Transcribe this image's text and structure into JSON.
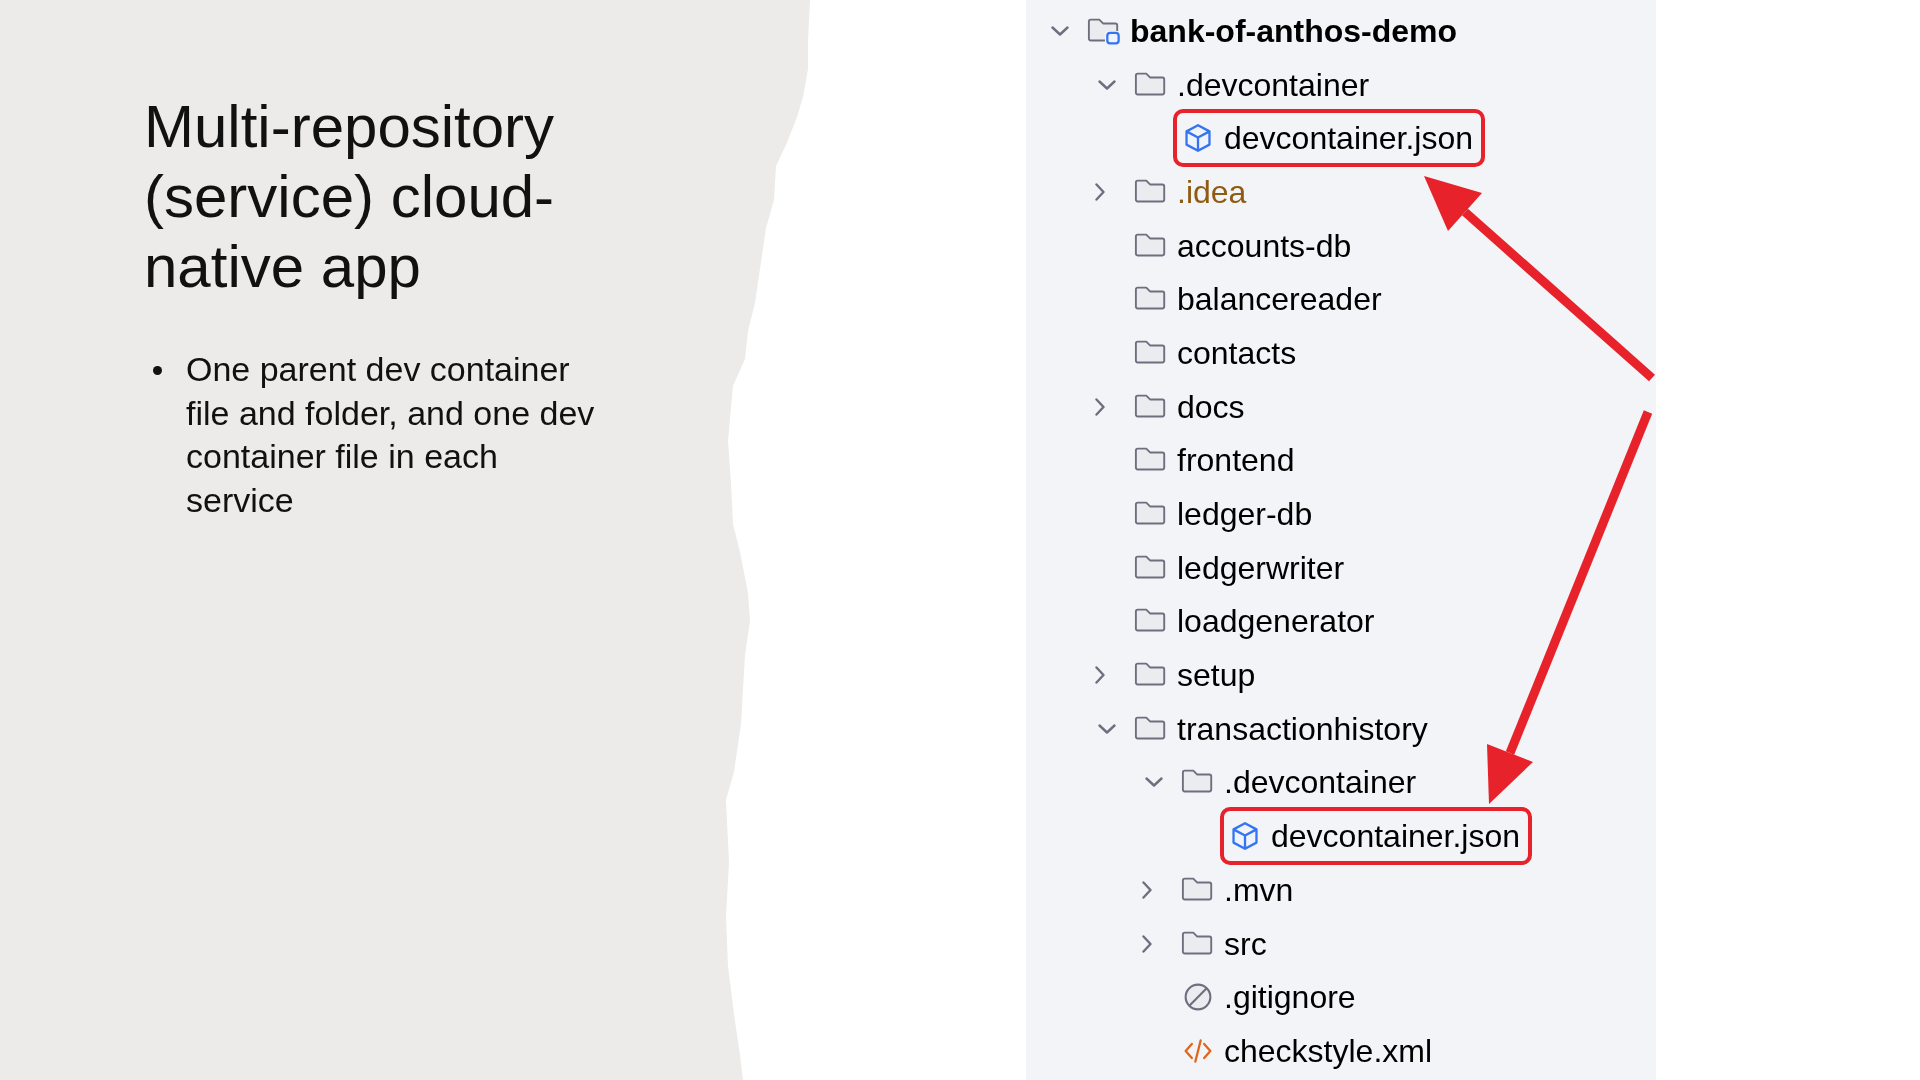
{
  "slide": {
    "title": "Multi-repository (service) cloud-native app",
    "bullets": [
      "One parent dev container file and folder, and one dev container file in each service"
    ]
  },
  "file_tree": {
    "items": [
      {
        "name": "bank-of-anthos-demo",
        "kind": "project",
        "expanded": true,
        "ignored": false,
        "highlighted": false,
        "children": [
          {
            "name": ".devcontainer",
            "kind": "folder",
            "expanded": true,
            "ignored": false,
            "highlighted": false,
            "children": [
              {
                "name": "devcontainer.json",
                "kind": "devcontainer",
                "ignored": false,
                "highlighted": true
              }
            ]
          },
          {
            "name": ".idea",
            "kind": "folder",
            "expanded": false,
            "ignored": true,
            "highlighted": false
          },
          {
            "name": "accounts-db",
            "kind": "folder",
            "ignored": false,
            "highlighted": false
          },
          {
            "name": "balancereader",
            "kind": "folder",
            "ignored": false,
            "highlighted": false
          },
          {
            "name": "contacts",
            "kind": "folder",
            "ignored": false,
            "highlighted": false
          },
          {
            "name": "docs",
            "kind": "folder",
            "expanded": false,
            "ignored": false,
            "highlighted": false
          },
          {
            "name": "frontend",
            "kind": "folder",
            "ignored": false,
            "highlighted": false
          },
          {
            "name": "ledger-db",
            "kind": "folder",
            "ignored": false,
            "highlighted": false
          },
          {
            "name": "ledgerwriter",
            "kind": "folder",
            "ignored": false,
            "highlighted": false
          },
          {
            "name": "loadgenerator",
            "kind": "folder",
            "ignored": false,
            "highlighted": false
          },
          {
            "name": "setup",
            "kind": "folder",
            "expanded": false,
            "ignored": false,
            "highlighted": false
          },
          {
            "name": "transactionhistory",
            "kind": "folder",
            "expanded": true,
            "ignored": false,
            "highlighted": false,
            "children": [
              {
                "name": ".devcontainer",
                "kind": "folder",
                "expanded": true,
                "ignored": false,
                "highlighted": false,
                "children": [
                  {
                    "name": "devcontainer.json",
                    "kind": "devcontainer",
                    "ignored": false,
                    "highlighted": true
                  }
                ]
              },
              {
                "name": ".mvn",
                "kind": "folder",
                "expanded": false,
                "ignored": false,
                "highlighted": false
              },
              {
                "name": "src",
                "kind": "folder",
                "expanded": false,
                "ignored": false,
                "highlighted": false
              },
              {
                "name": ".gitignore",
                "kind": "ignore",
                "ignored": false,
                "highlighted": false
              },
              {
                "name": "checkstyle.xml",
                "kind": "xml",
                "ignored": false,
                "highlighted": false
              }
            ]
          }
        ]
      }
    ]
  }
}
